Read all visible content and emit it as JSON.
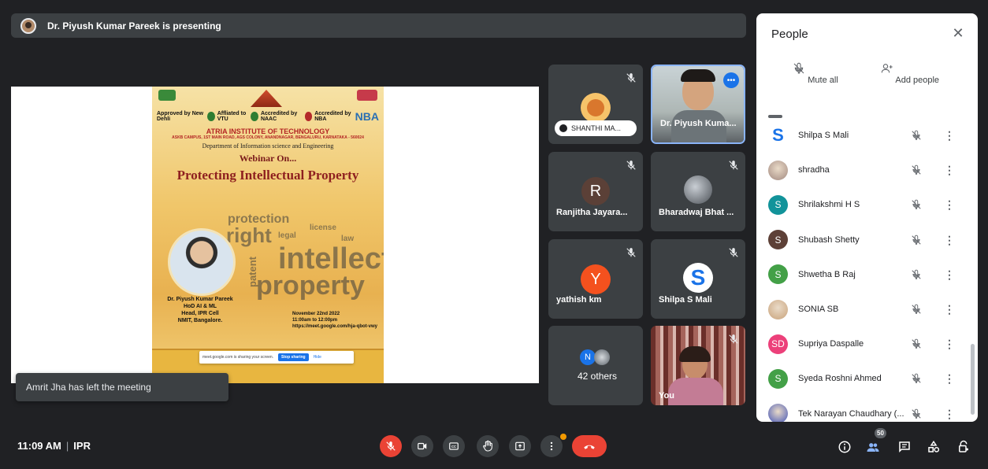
{
  "presenter_bar": {
    "text": "Dr. Piyush Kumar Pareek is presenting"
  },
  "poster": {
    "approved": "Approved by New Dehli",
    "affiliated": "Affliated to VTU",
    "naac": "Accredited by NAAC",
    "nba_label": "Accredited by NBA",
    "nba": "NBA",
    "institute": "ATRIA INSTITUTE OF TECHNOLOGY",
    "address": "ASKB CAMPUS, 1ST MAIN ROAD, AGS COLONY, ANANDNAGAR, BENGALURU, KARNATAKA - 560024",
    "department": "Department of Information science and Engineering",
    "webinar": "Webinar On...",
    "title": "Protecting Intellectual Property",
    "speaker_name": "Dr. Piyush Kumar Pareek",
    "speaker_role1": "HoD AI & ML",
    "speaker_role2": "Head, IPR Cell",
    "speaker_org": "NMIT, Bangalore.",
    "date": "November 22nd 2022",
    "time": "11:00am to 12:00pm",
    "link": "https://meet.google.com/hja-qbot-vwy",
    "words": [
      "protection",
      "right",
      "legal",
      "license",
      "intellect",
      "patent",
      "property",
      "law"
    ],
    "share_text": "meet.google.com is sharing your screen.",
    "stop_sharing": "Stop sharing",
    "hide": "Hide"
  },
  "toast": {
    "text": "Amrit Jha has left the meeting"
  },
  "tiles": [
    {
      "name": "SHANTHI MA...",
      "type": "pill"
    },
    {
      "name": "Dr. Piyush Kuma...",
      "type": "video"
    },
    {
      "name": "Ranjitha Jayara...",
      "initial": "R",
      "color": "#5b4037"
    },
    {
      "name": "Bharadwaj Bhat ...",
      "type": "photo"
    },
    {
      "name": "yathish km",
      "initial": "Y",
      "color": "#f4511e"
    },
    {
      "name": "Shilpa S Mali",
      "initial": "S",
      "color": "#ffffff"
    },
    {
      "name": "42 others",
      "initial": "N",
      "color": "#1a73e8"
    },
    {
      "name": "You",
      "type": "video"
    }
  ],
  "panel": {
    "title": "People",
    "mute_all": "Mute all",
    "add_people": "Add people",
    "participants": [
      {
        "name": "Shilpa S Mali",
        "initial": "S",
        "color": "#1a73e8",
        "style": "logo"
      },
      {
        "name": "shradha",
        "initial": "",
        "color": "#a1887f",
        "style": "photo"
      },
      {
        "name": "Shrilakshmi H S",
        "initial": "S",
        "color": "#12939a",
        "style": "circle"
      },
      {
        "name": "Shubash Shetty",
        "initial": "S",
        "color": "#5d4037",
        "style": "circle"
      },
      {
        "name": "Shwetha B Raj",
        "initial": "S",
        "color": "#43a047",
        "style": "circle"
      },
      {
        "name": "SONIA SB",
        "initial": "",
        "color": "#c8a27a",
        "style": "photo"
      },
      {
        "name": "Supriya Daspalle",
        "initial": "SD",
        "color": "#ec407a",
        "style": "circle"
      },
      {
        "name": "Syeda Roshni Ahmed",
        "initial": "S",
        "color": "#43a047",
        "style": "circle"
      },
      {
        "name": "Tek Narayan Chaudhary (...",
        "initial": "",
        "color": "#3f51b5",
        "style": "photo"
      }
    ]
  },
  "bottom": {
    "time": "11:09 AM",
    "meeting_code": "IPR",
    "people_count": "50"
  },
  "colors": {
    "background": "#202124",
    "tile": "#3c4043",
    "end_call": "#ea4335",
    "accent": "#1a73e8"
  }
}
